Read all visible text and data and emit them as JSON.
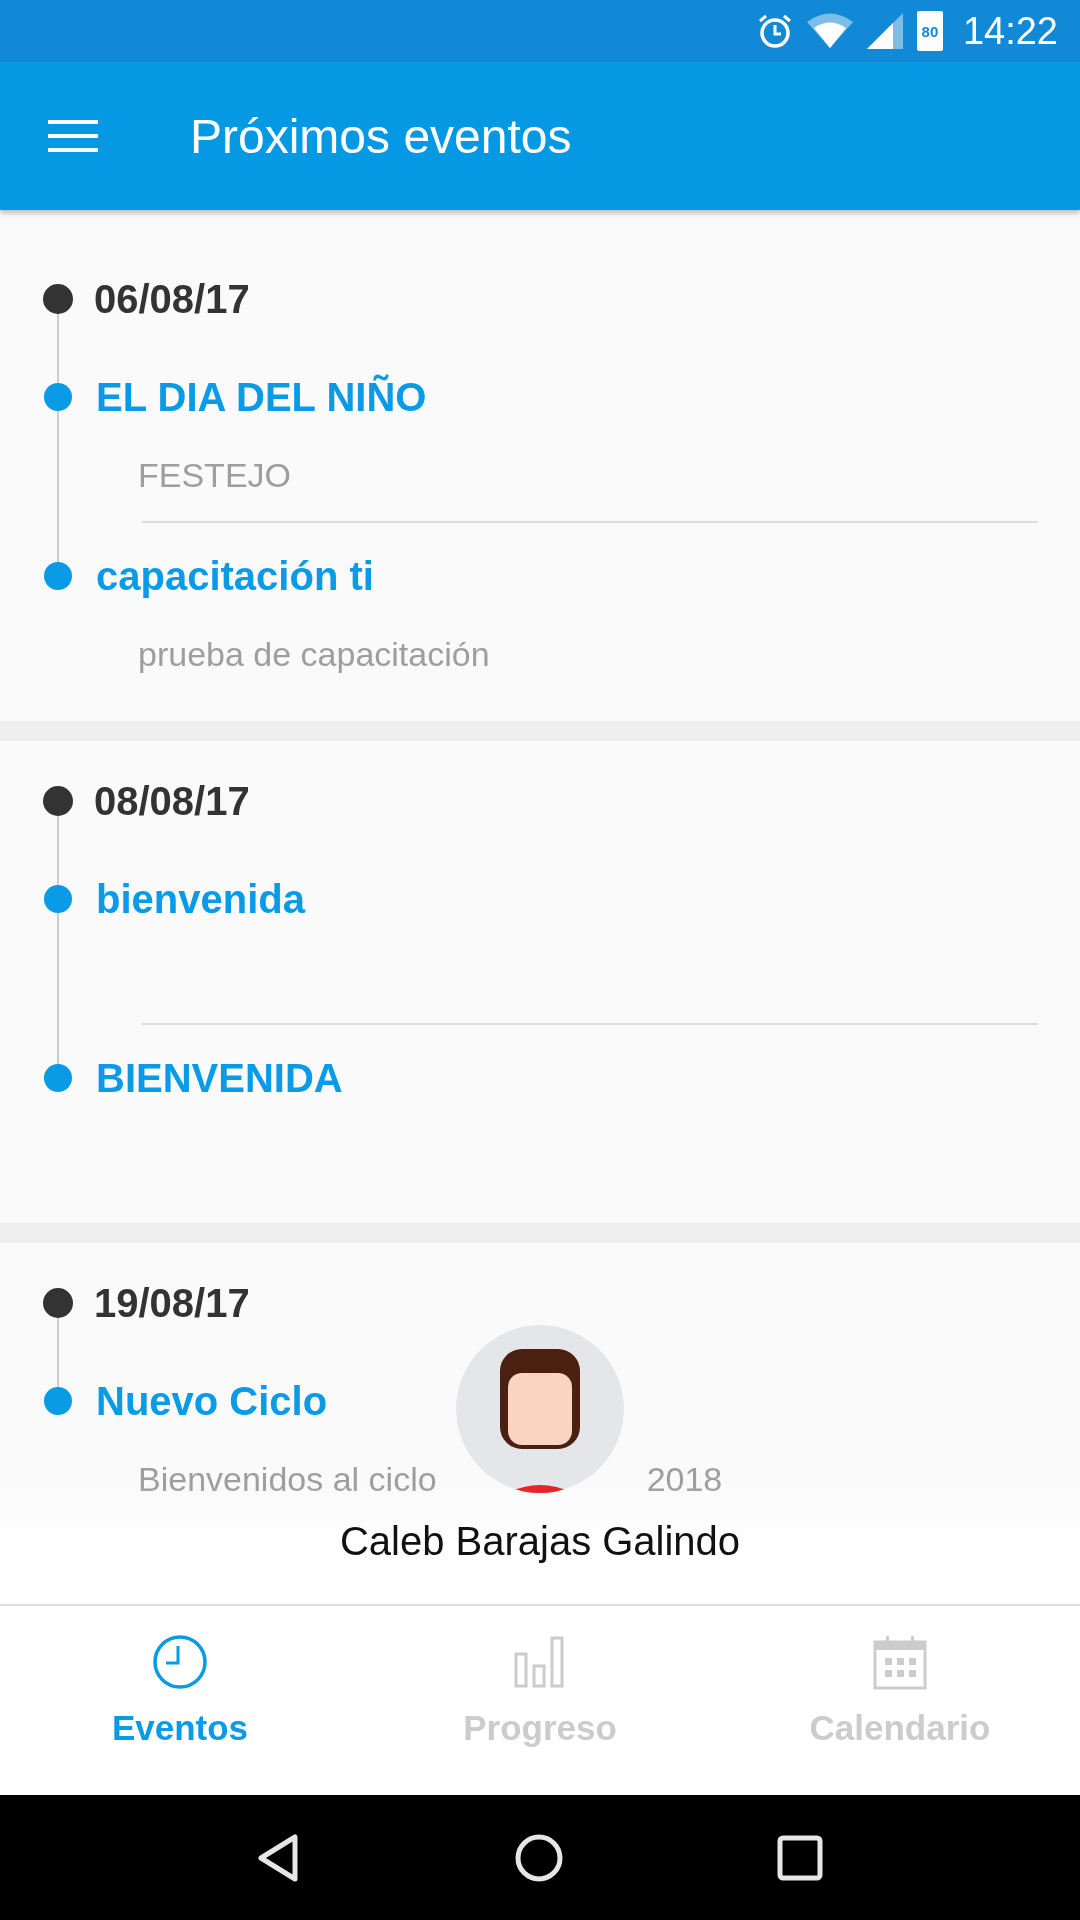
{
  "status_bar": {
    "battery": "80",
    "time": "14:22"
  },
  "app_bar": {
    "title": "Próximos eventos"
  },
  "days": [
    {
      "date": "06/08/17",
      "events": [
        {
          "title": "EL DIA DEL NIÑO",
          "description": [
            "FESTEJO"
          ]
        },
        {
          "title": "capacitación ti",
          "description": [
            "prueba de capacitación"
          ]
        }
      ]
    },
    {
      "date": "08/08/17",
      "events": [
        {
          "title": "bienvenida"
        },
        {
          "title": "BIENVENIDA"
        }
      ]
    },
    {
      "date": "19/08/17",
      "events": [
        {
          "title": "Nuevo Ciclo",
          "description": [
            "Bienvenidos al ciclo",
            "2018"
          ]
        }
      ]
    }
  ],
  "profile": {
    "name": "Caleb Barajas Galindo"
  },
  "bottom_nav": [
    {
      "label": "Eventos",
      "kind": "clock",
      "selected": true
    },
    {
      "label": "Progreso",
      "kind": "chart",
      "selected": false
    },
    {
      "label": "Calendario",
      "kind": "calendar",
      "selected": false
    }
  ]
}
